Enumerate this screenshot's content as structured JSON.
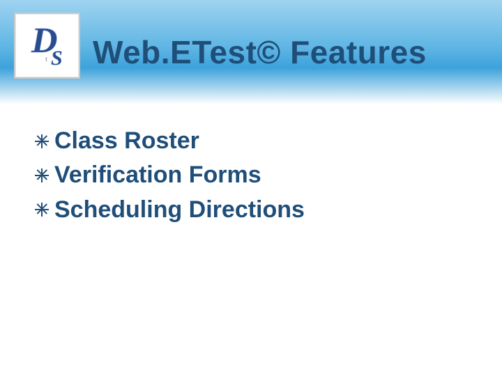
{
  "header": {
    "title": "Web.ETest© Features",
    "logo_text_d": "D",
    "logo_text_s": "S"
  },
  "bullets": {
    "items": [
      {
        "label": "Class Roster"
      },
      {
        "label": "Verification Forms"
      },
      {
        "label": "Scheduling Directions"
      }
    ]
  },
  "colors": {
    "heading": "#1f4e79",
    "band_top": "#9fd3f0",
    "band_mid": "#5fb6e4"
  }
}
